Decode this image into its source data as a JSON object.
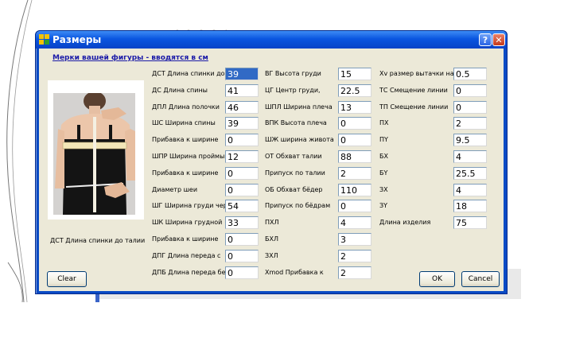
{
  "window": {
    "title": "Размеры",
    "help_btn": "?",
    "close_btn": "✕"
  },
  "subtitle": "Мерки вашей фигуры - вводятся в см",
  "photo_caption": "ДСТ Длина спинки до талии",
  "columns": [
    {
      "rows": [
        {
          "label": "ДСТ Длина спинки до",
          "value": "39"
        },
        {
          "label": "ДС Длина спины",
          "value": "41"
        },
        {
          "label": "ДПЛ Длина полочки",
          "value": "46"
        },
        {
          "label": "ШС Ширина спины",
          "value": "39"
        },
        {
          "label": "Прибавка к ширине",
          "value": "0"
        },
        {
          "label": "ШПР Ширина проймы",
          "value": "12"
        },
        {
          "label": "Прибавка к ширине",
          "value": "0"
        },
        {
          "label": "Диаметр шеи",
          "value": "0"
        },
        {
          "label": "ШГ Ширина груди через",
          "value": "54"
        },
        {
          "label": "ШК Ширина грудной",
          "value": "33"
        },
        {
          "label": "Прибавка к ширине",
          "value": "0"
        },
        {
          "label": "ДПГ Длина переда с",
          "value": "0"
        },
        {
          "label": "ДПБ Длина переда без",
          "value": "0"
        }
      ]
    },
    {
      "rows": [
        {
          "label": "ВГ Высота груди",
          "value": "15"
        },
        {
          "label": "ЦГ Центр груди,",
          "value": "22.5"
        },
        {
          "label": "ШПЛ Ширина плеча",
          "value": "13"
        },
        {
          "label": "ВПК Высота плеча",
          "value": "0"
        },
        {
          "label": "ШЖ ширина живота",
          "value": "0"
        },
        {
          "label": "ОТ Обхват талии",
          "value": "88"
        },
        {
          "label": "Припуск по талии",
          "value": "2"
        },
        {
          "label": "ОБ Обхват бёдер",
          "value": "110"
        },
        {
          "label": "Припуск по бёдрам",
          "value": "0"
        },
        {
          "label": "ПХЛ",
          "value": "4"
        },
        {
          "label": "БХЛ",
          "value": "3"
        },
        {
          "label": "ЗХЛ",
          "value": "2"
        },
        {
          "label": "Xmod Прибавка к",
          "value": "2"
        }
      ]
    },
    {
      "rows": [
        {
          "label": "Xv размер вытачки на",
          "value": "0.5"
        },
        {
          "label": "ТС Смещение линии",
          "value": "0"
        },
        {
          "label": "ТП Смещение линии",
          "value": "0"
        },
        {
          "label": "ПХ",
          "value": "2"
        },
        {
          "label": "ПY",
          "value": "9.5"
        },
        {
          "label": "БХ",
          "value": "4"
        },
        {
          "label": "БY",
          "value": "25.5"
        },
        {
          "label": "ЗХ",
          "value": "4"
        },
        {
          "label": "ЗY",
          "value": "18"
        },
        {
          "label": "Длина изделия",
          "value": "75"
        }
      ]
    }
  ],
  "buttons": {
    "clear": "Clear",
    "ok": "OK",
    "cancel": "Cancel"
  },
  "colors": {
    "title_bar": "#0a55e0",
    "dialog_face": "#ece9d8",
    "selection": "#316ac5",
    "subtitle_link": "#1a1aa8"
  }
}
